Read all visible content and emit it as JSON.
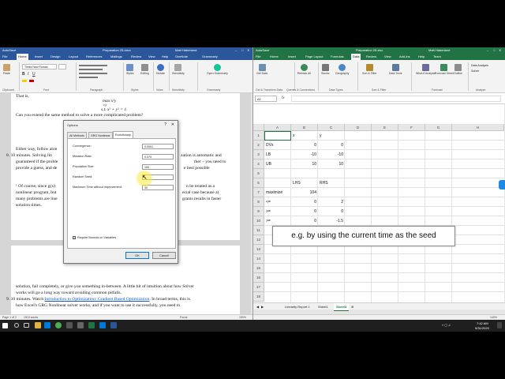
{
  "word": {
    "autosave": "AutoSave",
    "title": "Preparation 25.docx",
    "user": "Matt Haberland",
    "tabs": [
      "File",
      "Home",
      "Insert",
      "Design",
      "Layout",
      "References",
      "Mailings",
      "Review",
      "View",
      "Help",
      "OneNote",
      "Grammarly"
    ],
    "active_tab": "Home",
    "ribbon": {
      "paste": "Paste",
      "font_name": "Times New Roman",
      "styles": "Styles",
      "editing": "Editing",
      "dictate": "Dictate",
      "sensitivity": "Sensitivity",
      "open_grammarly": "Open Grammarly",
      "groups": [
        "Clipboard",
        "Font",
        "Paragraph",
        "Styles",
        "Voice",
        "Sensitivity",
        "Grammarly"
      ]
    },
    "doc": {
      "line1": "That is,",
      "math1": "max x²y",
      "math1_sub": "x,y",
      "math2": "s.t.  x² + y² = 1.",
      "line2": "Can you extend the same method to solve a more complicated problem?",
      "line3_a": "Either way, follow alon",
      "line4_a": "8.  10 minutes. Solving lin",
      "line4_b": "zation is automatic and",
      "line5_a": "guaranteed if the proble",
      "line5_b": "ther – you need to",
      "line6_a": "provide a guess, and de",
      "line6_b": "e best possible",
      "fn1_a": "¹ Of course, since g(x)",
      "fn1_b": "n be treated as a",
      "fn2_a": "nonlinear program, but",
      "fn2_b": "ecial case because a)",
      "fn3_a": "many problems are line",
      "fn3_b": "grams results in faster",
      "fn4": "solution times.",
      "line7": "solution, fail completely, or give you something in-between. A little bit of intuition about how Solver",
      "line8": "works will go a long way toward avoiding common pitfalls.",
      "line9_a": "9.  10 minutes. Watch ",
      "line9_link": "Introduction to Optimization: Gradient Based Optimization",
      "line9_b": ". In broad terms, this is",
      "line10": "how Excel's GRG Nonlinear solver works, and if you want to use it successfully, you need to"
    },
    "status": {
      "page": "Page 1 of 2",
      "words": "1510 words",
      "focus": "Focus",
      "zoom": "150%"
    }
  },
  "dialog": {
    "title": "Options",
    "help": "?",
    "close": "✕",
    "tabs": [
      "All Methods",
      "GRG Nonlinear",
      "Evolutionary"
    ],
    "active_tab": "Evolutionary",
    "fields": [
      {
        "label": "Convergence:",
        "value": "0.0001"
      },
      {
        "label": "Mutation Rate:",
        "value": "0.075"
      },
      {
        "label": "Population Size:",
        "value": "100"
      },
      {
        "label": "Random Seed:",
        "value": "1"
      },
      {
        "label": "Maximum Time without improvement:",
        "value": "30"
      }
    ],
    "checkbox_label": "Require Bounds on Variables",
    "checkbox_checked": true,
    "ok": "OK",
    "cancel": "Cancel"
  },
  "excel": {
    "autosave": "AutoSave",
    "title": "Preparation 25.xlsx",
    "user": "Matt Haberland",
    "tabs": [
      "File",
      "Home",
      "Insert",
      "Page Layout",
      "Formulas",
      "Data",
      "Review",
      "View",
      "Add-ins",
      "Help",
      "Team"
    ],
    "active_tab": "Data",
    "ribbon": {
      "get_data": "Get Data",
      "refresh_all": "Refresh All",
      "stocks": "Stocks",
      "geography": "Geography",
      "sort_filter": "Sort & Filter",
      "data_tools": "Data Tools",
      "what_if": "What-If Analysis",
      "forecast_sheet": "Forecast Sheet",
      "outline": "Outline",
      "data_analysis": "Data Analysis",
      "solver": "Solver",
      "groups": [
        "Get & Transform Data",
        "Queries & Connections",
        "Data Types",
        "Sort & Filter",
        "Forecast",
        "Analyze"
      ]
    },
    "name_box": "A1",
    "fx": "fx",
    "columns": [
      "A",
      "B",
      "C",
      "D",
      "E",
      "F",
      "G",
      "H"
    ],
    "rows": [
      "1",
      "2",
      "3",
      "4",
      "5",
      "6",
      "7",
      "8",
      "9",
      "10",
      "11",
      "12",
      "13",
      "14",
      "15",
      "16",
      "17",
      "18"
    ],
    "cells": {
      "B1": "x",
      "C1": "y",
      "A2": "DVs",
      "B2": "0",
      "C2": "0",
      "A3": "LB",
      "B3": "-10",
      "C3": "-10",
      "A4": "UB",
      "B4": "10",
      "C4": "10",
      "B6": "LHS",
      "C6": "RHS",
      "A7": "maximize",
      "B7": "104",
      "A8": "<=",
      "B8": "0",
      "C8": "2",
      "A9": ">=",
      "B9": "0",
      "C9": "0",
      "A10": ">=",
      "B10": "0",
      "C10": "-1.5"
    },
    "sheets": [
      "Linearity Report 1",
      "Sheet1",
      "Sheet3"
    ],
    "active_sheet": "Sheet3",
    "status_zoom": "140%"
  },
  "caption": "e.g. by using the current time as the seed",
  "taskbar": {
    "time": "7:42 AM",
    "date": "5/31/2020"
  },
  "colors": {
    "word_blue": "#2b579a",
    "excel_green": "#217346",
    "highlight_yellow": "#ffeb3c"
  }
}
